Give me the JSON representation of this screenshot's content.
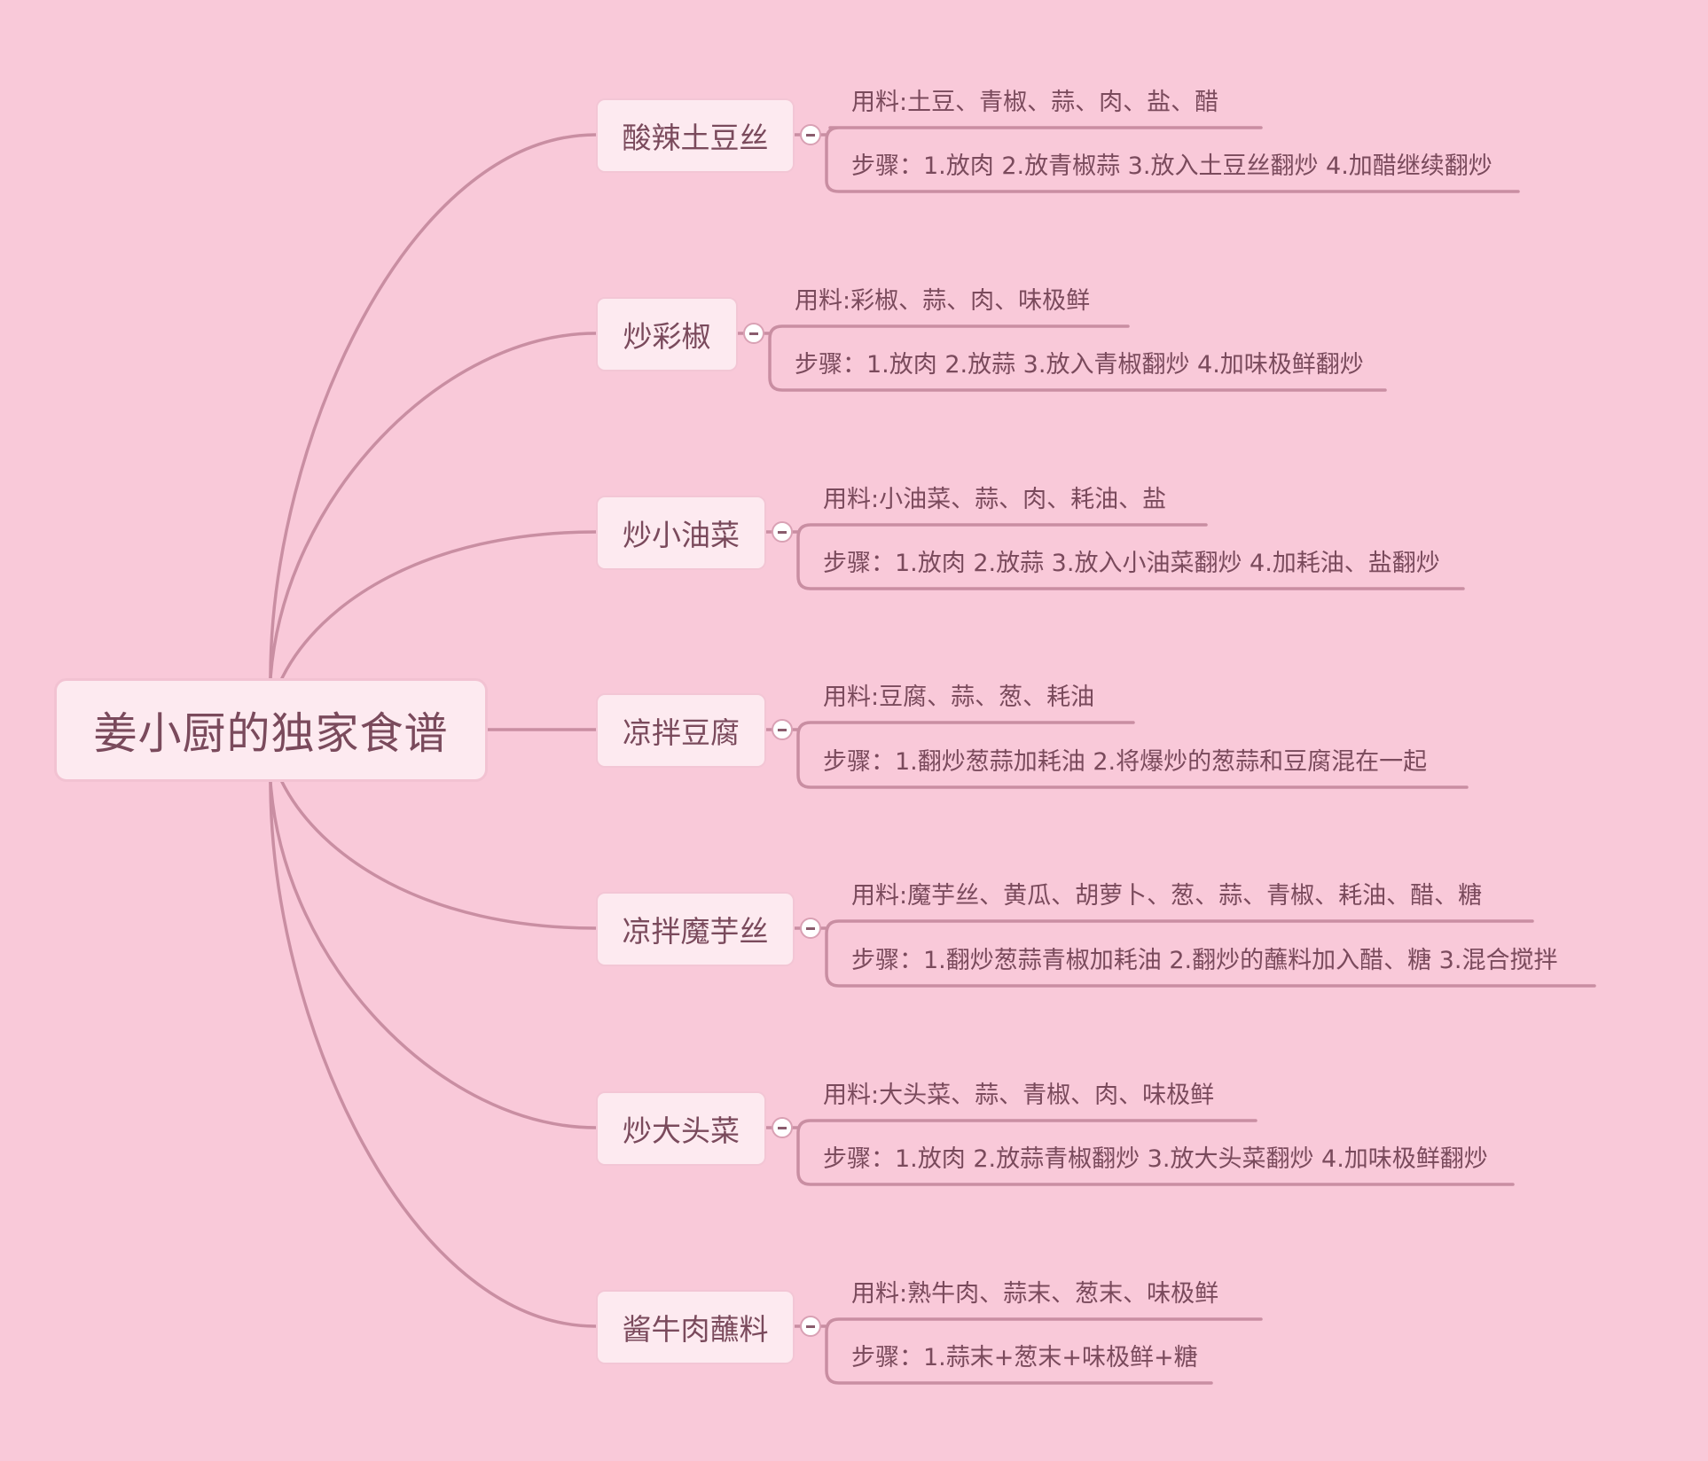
{
  "colors": {
    "background": "#f9c9d9",
    "node_fill": "#fdeaf0",
    "connector": "#c98ea2",
    "text": "#7a4a5c"
  },
  "mindmap": {
    "root": "姜小厨的独家食谱",
    "topics": [
      {
        "title": "酸辣土豆丝",
        "ingredients": "用料:土豆、青椒、蒜、肉、盐、醋",
        "steps": "步骤：1.放肉 2.放青椒蒜 3.放入土豆丝翻炒 4.加醋继续翻炒"
      },
      {
        "title": "炒彩椒",
        "ingredients": "用料:彩椒、蒜、肉、味极鲜",
        "steps": "步骤：1.放肉 2.放蒜 3.放入青椒翻炒 4.加味极鲜翻炒"
      },
      {
        "title": "炒小油菜",
        "ingredients": "用料:小油菜、蒜、肉、耗油、盐",
        "steps": "步骤：1.放肉 2.放蒜 3.放入小油菜翻炒 4.加耗油、盐翻炒"
      },
      {
        "title": "凉拌豆腐",
        "ingredients": "用料:豆腐、蒜、葱、耗油",
        "steps": "步骤：1.翻炒葱蒜加耗油 2.将爆炒的葱蒜和豆腐混在一起"
      },
      {
        "title": "凉拌魔芋丝",
        "ingredients": "用料:魔芋丝、黄瓜、胡萝卜、葱、蒜、青椒、耗油、醋、糖",
        "steps": "步骤：1.翻炒葱蒜青椒加耗油 2.翻炒的蘸料加入醋、糖 3.混合搅拌"
      },
      {
        "title": "炒大头菜",
        "ingredients": "用料:大头菜、蒜、青椒、肉、味极鲜",
        "steps": "步骤：1.放肉 2.放蒜青椒翻炒 3.放大头菜翻炒 4.加味极鲜翻炒"
      },
      {
        "title": "酱牛肉蘸料",
        "ingredients": "用料:熟牛肉、蒜末、葱末、味极鲜",
        "steps": "步骤：1.蒜末+葱末+味极鲜+糖"
      }
    ]
  }
}
